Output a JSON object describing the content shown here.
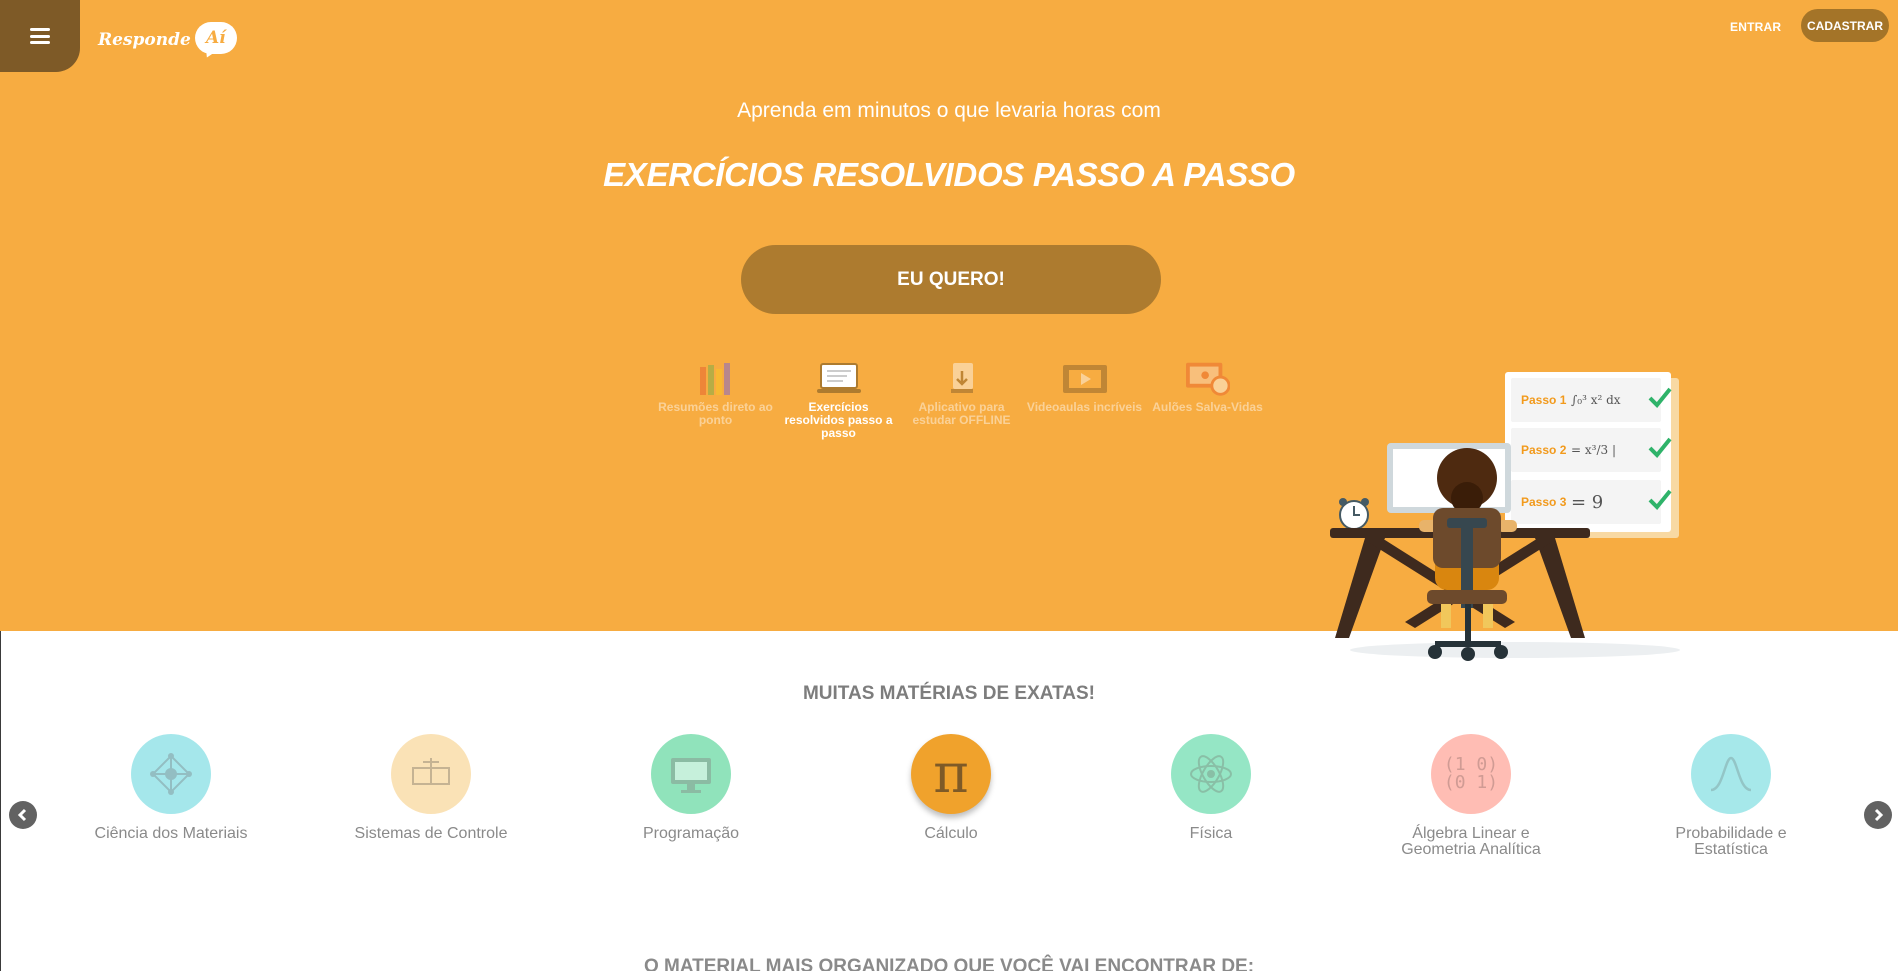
{
  "header": {
    "logo_text": "Responde",
    "logo_bubble": "Aí",
    "login_label": "ENTRAR",
    "signup_label": "CADASTRAR"
  },
  "hero": {
    "subtitle": "Aprenda em minutos o que levaria horas com",
    "title": "EXERCÍCIOS RESOLVIDOS PASSO A PASSO",
    "cta_label": "EU QUERO!",
    "features": [
      {
        "label": "Resumões direto ao ponto",
        "icon": "books-icon"
      },
      {
        "label": "Exercícios resolvidos passo a passo",
        "icon": "laptop-icon"
      },
      {
        "label": "Aplicativo para estudar OFFLINE",
        "icon": "download-icon"
      },
      {
        "label": "Videoaulas incríveis",
        "icon": "video-icon"
      },
      {
        "label": "Aulões Salva-Vidas",
        "icon": "lifesaver-video-icon"
      }
    ],
    "active_feature": "Exercícios resolvidos passo a passo",
    "steps": [
      {
        "label": "Passo 1",
        "math": "∫₀³ x² dx"
      },
      {
        "label": "Passo 2",
        "math": "= x³/3 |"
      },
      {
        "label": "Passo 3",
        "math": "= 9"
      }
    ]
  },
  "subjects": {
    "title": "MUITAS MATÉRIAS DE EXATAS!",
    "items": [
      {
        "line1": "Ciência dos Materiais",
        "line2": "",
        "color": "#4dd0d8",
        "icon": "crystal-lattice-icon"
      },
      {
        "line1": "Sistemas de Controle",
        "line2": "",
        "color": "#f7c66f",
        "icon": "control-diagram-icon"
      },
      {
        "line1": "Programação",
        "line2": "",
        "color": "#23c87a",
        "icon": "monitor-code-icon"
      },
      {
        "line1": "Cálculo",
        "line2": "",
        "color": "#f0a22c",
        "icon": "pi-icon"
      },
      {
        "line1": "Física",
        "line2": "",
        "color": "#2ecf8d",
        "icon": "atom-icon"
      },
      {
        "line1": "Álgebra Linear e",
        "line2": "Geometria Analítica",
        "color": "#ff7e6b",
        "icon": "matrix-icon"
      },
      {
        "line1": "Probabilidade e",
        "line2": "Estatística",
        "color": "#4fd3d6",
        "icon": "bell-curve-icon"
      }
    ],
    "active_subject": "Cálculo",
    "bottom_text": "O MATERIAL MAIS ORGANIZADO QUE VOCÊ VAI ENCONTRAR DE:"
  },
  "colors": {
    "hero_bg": "#f7ac41",
    "menu_tab": "#7e5a27",
    "cta": "#ad7b2f",
    "step_label": "#f29a1c",
    "check": "#2fb36a"
  }
}
